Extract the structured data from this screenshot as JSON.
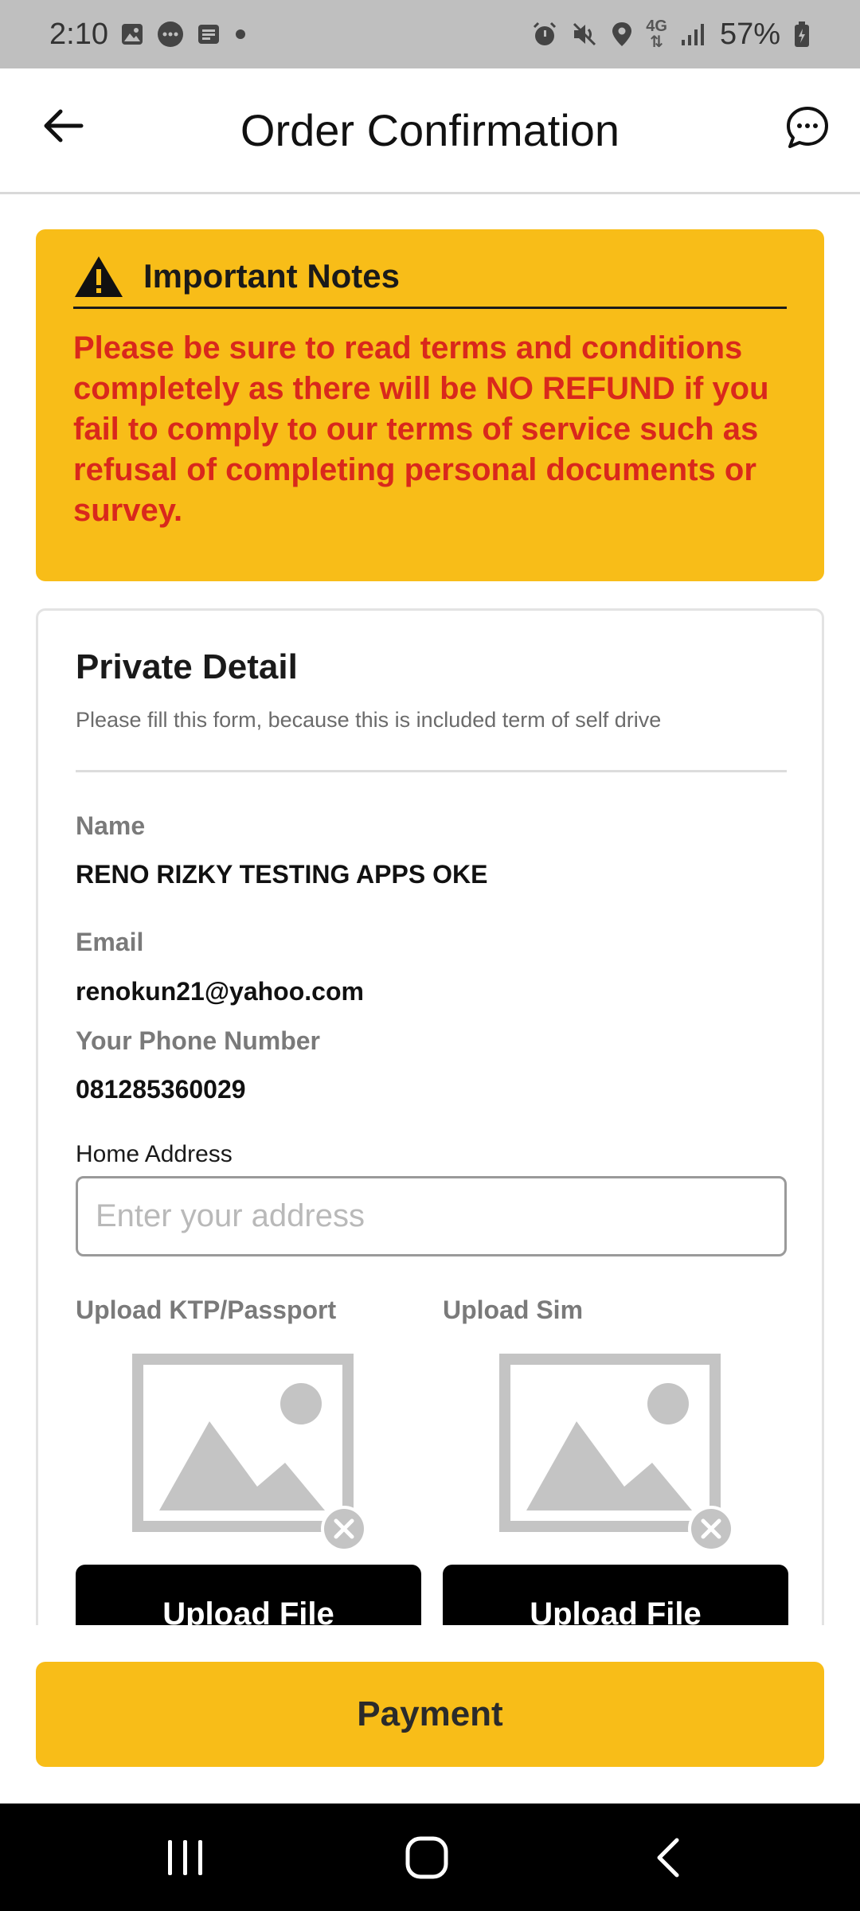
{
  "status_bar": {
    "time": "2:10",
    "network": "4G",
    "battery": "57%"
  },
  "app_bar": {
    "title": "Order Confirmation"
  },
  "notes": {
    "title": "Important Notes",
    "lines": [
      "Please be sure to read terms and conditions",
      "completely as there will be NO REFUND if you",
      "fail to comply to our terms of service such as",
      "refusal of completing personal documents or",
      "survey."
    ]
  },
  "private_detail": {
    "title": "Private Detail",
    "subtitle": "Please fill this form, because this is included term of self drive",
    "name_label": "Name",
    "name_value": "RENO RIZKY TESTING APPS OKE",
    "email_label": "Email",
    "email_value": "renokun21@yahoo.com",
    "phone_label": "Your Phone Number",
    "phone_value": "081285360029",
    "address_label": "Home Address",
    "address_placeholder": "Enter your address",
    "upload_ktp_label": "Upload KTP/Passport",
    "upload_sim_label": "Upload Sim",
    "upload_button_label": "Upload File"
  },
  "payment_button": "Payment",
  "colors": {
    "accent": "#f8bd18",
    "warning_text": "#d9281c",
    "button_dark": "#000000"
  }
}
